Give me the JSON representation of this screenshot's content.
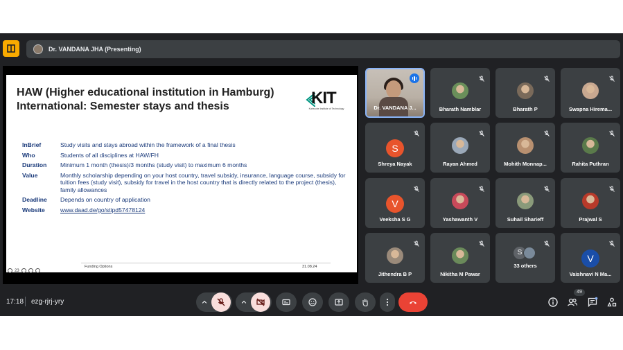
{
  "header": {
    "presenter": "Dr. VANDANA JHA (Presenting)"
  },
  "slide": {
    "title_line1": "HAW (Higher educational institution in Hamburg)",
    "title_line2": "International: Semester stays and thesis",
    "logo_text": "KIT",
    "logo_sub": "Karlsruhe Institute of Technology",
    "rows": [
      {
        "label": "InBrief",
        "value": "Study visits and stays abroad within the framework of a final thesis"
      },
      {
        "label": "Who",
        "value": "Students of all disciplines at HAW/FH"
      },
      {
        "label": "Duration",
        "value": "Minimum 1 month (thesis)/3 months (study visit) to maximum 6 months"
      },
      {
        "label": "Value",
        "value": "Monthly scholarship depending on your host country, travel subsidy, insurance, language course, subsidy for tuition fees (study visit), subsidy for travel in the host country that is directly related to the project (thesis), family allowances"
      },
      {
        "label": "Deadline",
        "value": "Depends on country of application"
      },
      {
        "label": "Website",
        "value": "www.daad.de/go/stipd57478124"
      }
    ],
    "footer_left": "Funding Options",
    "footer_right": "31.08.24",
    "page_num": "23"
  },
  "participants": [
    {
      "name": "Dr. VANDANA J...",
      "kind": "self"
    },
    {
      "name": "Bharath Namblar",
      "kind": "photo",
      "color": "#6a8f5a"
    },
    {
      "name": "Bharath P",
      "kind": "photo",
      "color": "#7a6a5a"
    },
    {
      "name": "Swapna Hirema...",
      "kind": "photo",
      "color": "#c8a890"
    },
    {
      "name": "Shreya Nayak",
      "kind": "letter",
      "letter": "S",
      "color": "#e8542c"
    },
    {
      "name": "Rayan Ahmed",
      "kind": "photo",
      "color": "#9aa8b8"
    },
    {
      "name": "Mohith Monnap...",
      "kind": "photo",
      "color": "#b89070"
    },
    {
      "name": "Rahita Puthran",
      "kind": "photo",
      "color": "#5a7a4a"
    },
    {
      "name": "Veeksha S G",
      "kind": "letter",
      "letter": "V",
      "color": "#e8542c"
    },
    {
      "name": "Yashawanth V",
      "kind": "photo",
      "color": "#c84a5a"
    },
    {
      "name": "Suhail Sharieff",
      "kind": "photo",
      "color": "#8a9a7a"
    },
    {
      "name": "Prajwal S",
      "kind": "photo",
      "color": "#b83a2a"
    },
    {
      "name": "Jithendra B P",
      "kind": "photo",
      "color": "#9a8a7a"
    },
    {
      "name": "Nikitha M Pawar",
      "kind": "photo",
      "color": "#6a8a5a"
    },
    {
      "name": "33 others",
      "kind": "others"
    },
    {
      "name": "Vaishnavi N Ma...",
      "kind": "letter",
      "letter": "V",
      "color": "#1a4ea8"
    }
  ],
  "others_letter": "S",
  "bottom": {
    "time": "17:18",
    "meeting_code": "ezg-rjrj-yry",
    "people_count": "49"
  },
  "colors": {
    "end_call": "#ea4335",
    "muted": "#f9dedc",
    "accent": "#8ab4f8"
  }
}
